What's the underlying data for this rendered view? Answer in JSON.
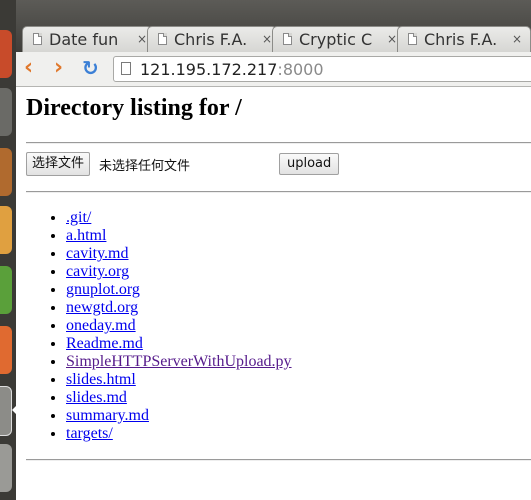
{
  "tabs": [
    {
      "title": "Date fun",
      "close": "×"
    },
    {
      "title": "Chris F.A.",
      "close": "×"
    },
    {
      "title": "Cryptic C",
      "close": "×"
    },
    {
      "title": "Chris F.A.",
      "close": "×"
    }
  ],
  "toolbar": {
    "back": "‹",
    "forward": "›",
    "reload": "↻",
    "url_host": "121.195.172.217",
    "url_port": ":8000"
  },
  "page": {
    "heading": "Directory listing for /",
    "upload_form": {
      "choose_button": "选择文件",
      "no_file_text": "未选择任何文件",
      "upload_button": "upload"
    },
    "entries": [
      {
        "name": ".git/",
        "visited": false
      },
      {
        "name": "a.html",
        "visited": false
      },
      {
        "name": "cavity.md",
        "visited": false
      },
      {
        "name": "cavity.org",
        "visited": false
      },
      {
        "name": "gnuplot.org",
        "visited": false
      },
      {
        "name": "newgtd.org",
        "visited": false
      },
      {
        "name": "oneday.md",
        "visited": false
      },
      {
        "name": "Readme.md",
        "visited": false
      },
      {
        "name": "SimpleHTTPServerWithUpload.py",
        "visited": true
      },
      {
        "name": "slides.html",
        "visited": false
      },
      {
        "name": "slides.md",
        "visited": false
      },
      {
        "name": "summary.md",
        "visited": false
      },
      {
        "name": "targets/",
        "visited": false
      }
    ]
  },
  "colors": {
    "link": "#0000ee",
    "visited_link": "#551a8b",
    "back_forward": "#e0782c",
    "reload": "#3c80d6"
  },
  "launcher_icons": [
    "ubuntu-dash-icon",
    "files-icon",
    "firefox-icon",
    "archive-icon",
    "spreadsheet-icon",
    "presentation-icon",
    "terminal-icon",
    "settings-icon"
  ]
}
